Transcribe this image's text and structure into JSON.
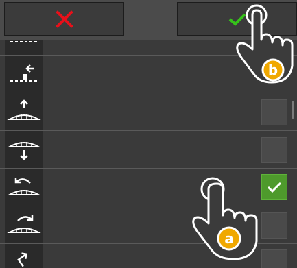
{
  "topbar": {
    "cancel_icon": "x-icon",
    "confirm_icon": "checkmark-icon"
  },
  "colors": {
    "cancel": "#e8101a",
    "confirm": "#35c21a",
    "checked_bg": "#4e9a2c",
    "callout": "#f0a800"
  },
  "rows": [
    {
      "icon": "boom-partial-icon",
      "checked": false
    },
    {
      "icon": "boom-retract-left-icon",
      "checked": false
    },
    {
      "icon": "boom-raise-icon",
      "checked": false
    },
    {
      "icon": "boom-lower-icon",
      "checked": false
    },
    {
      "icon": "boom-tilt-left-icon",
      "checked": true
    },
    {
      "icon": "boom-tilt-right-icon",
      "checked": false
    },
    {
      "icon": "boom-arrow-up-right-icon",
      "checked": false
    }
  ],
  "callouts": {
    "a": "a",
    "b": "b"
  }
}
